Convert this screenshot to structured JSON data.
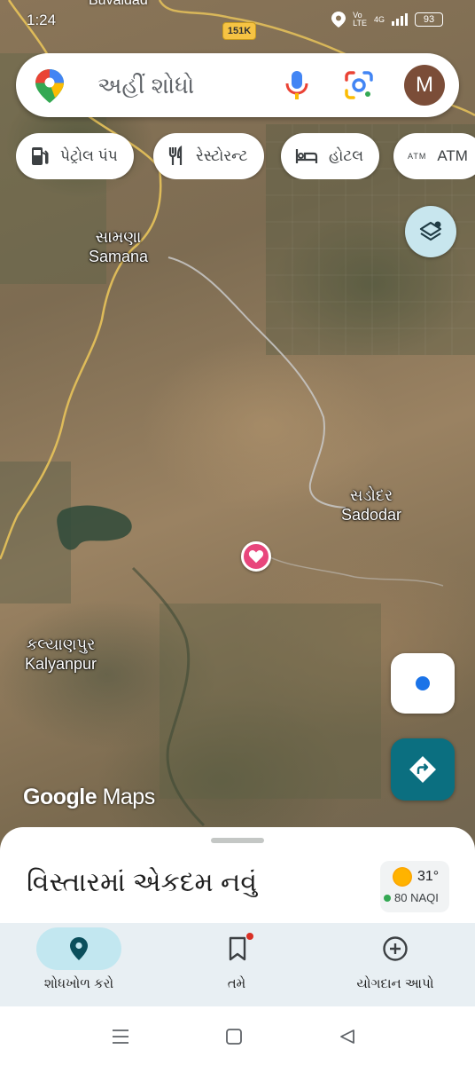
{
  "status_bar": {
    "time": "1:24",
    "battery": "93",
    "network": "4G"
  },
  "map": {
    "road_badge": "151K",
    "cut_label": "Buvaldad",
    "places": [
      {
        "gu": "સામણા",
        "en": "Samana"
      },
      {
        "gu": "સડોદર",
        "en": "Sadodar"
      },
      {
        "gu": "કલ્યાણપુર",
        "en": "Kalyanpur"
      }
    ],
    "watermark_google": "Google",
    "watermark_maps": "Maps"
  },
  "search": {
    "placeholder": "અહીં શોધો",
    "avatar_letter": "M"
  },
  "chips": [
    {
      "label": "પેટ્રોલ પંપ",
      "icon": "fuel-icon"
    },
    {
      "label": "રેસ્ટોરન્ટ",
      "icon": "restaurant-icon"
    },
    {
      "label": "હોટલ",
      "icon": "hotel-icon"
    },
    {
      "label": "ATM",
      "icon": "atm-icon"
    }
  ],
  "sheet": {
    "title": "વિસ્તારમાં એકદમ નવું",
    "weather": {
      "temp": "31°",
      "aqi": "80 NAQI"
    }
  },
  "bottom_nav": [
    {
      "label": "શોધખોળ કરો",
      "icon": "explore-pin-icon",
      "active": true
    },
    {
      "label": "તમે",
      "icon": "saved-bookmark-icon",
      "active": false
    },
    {
      "label": "યોગદાન આપો",
      "icon": "contribute-plus-icon",
      "active": false
    }
  ],
  "colors": {
    "accent": "#0b6f80",
    "pill": "#c2e7f0",
    "pin": "#e8467c",
    "badge": "#f6c343"
  }
}
